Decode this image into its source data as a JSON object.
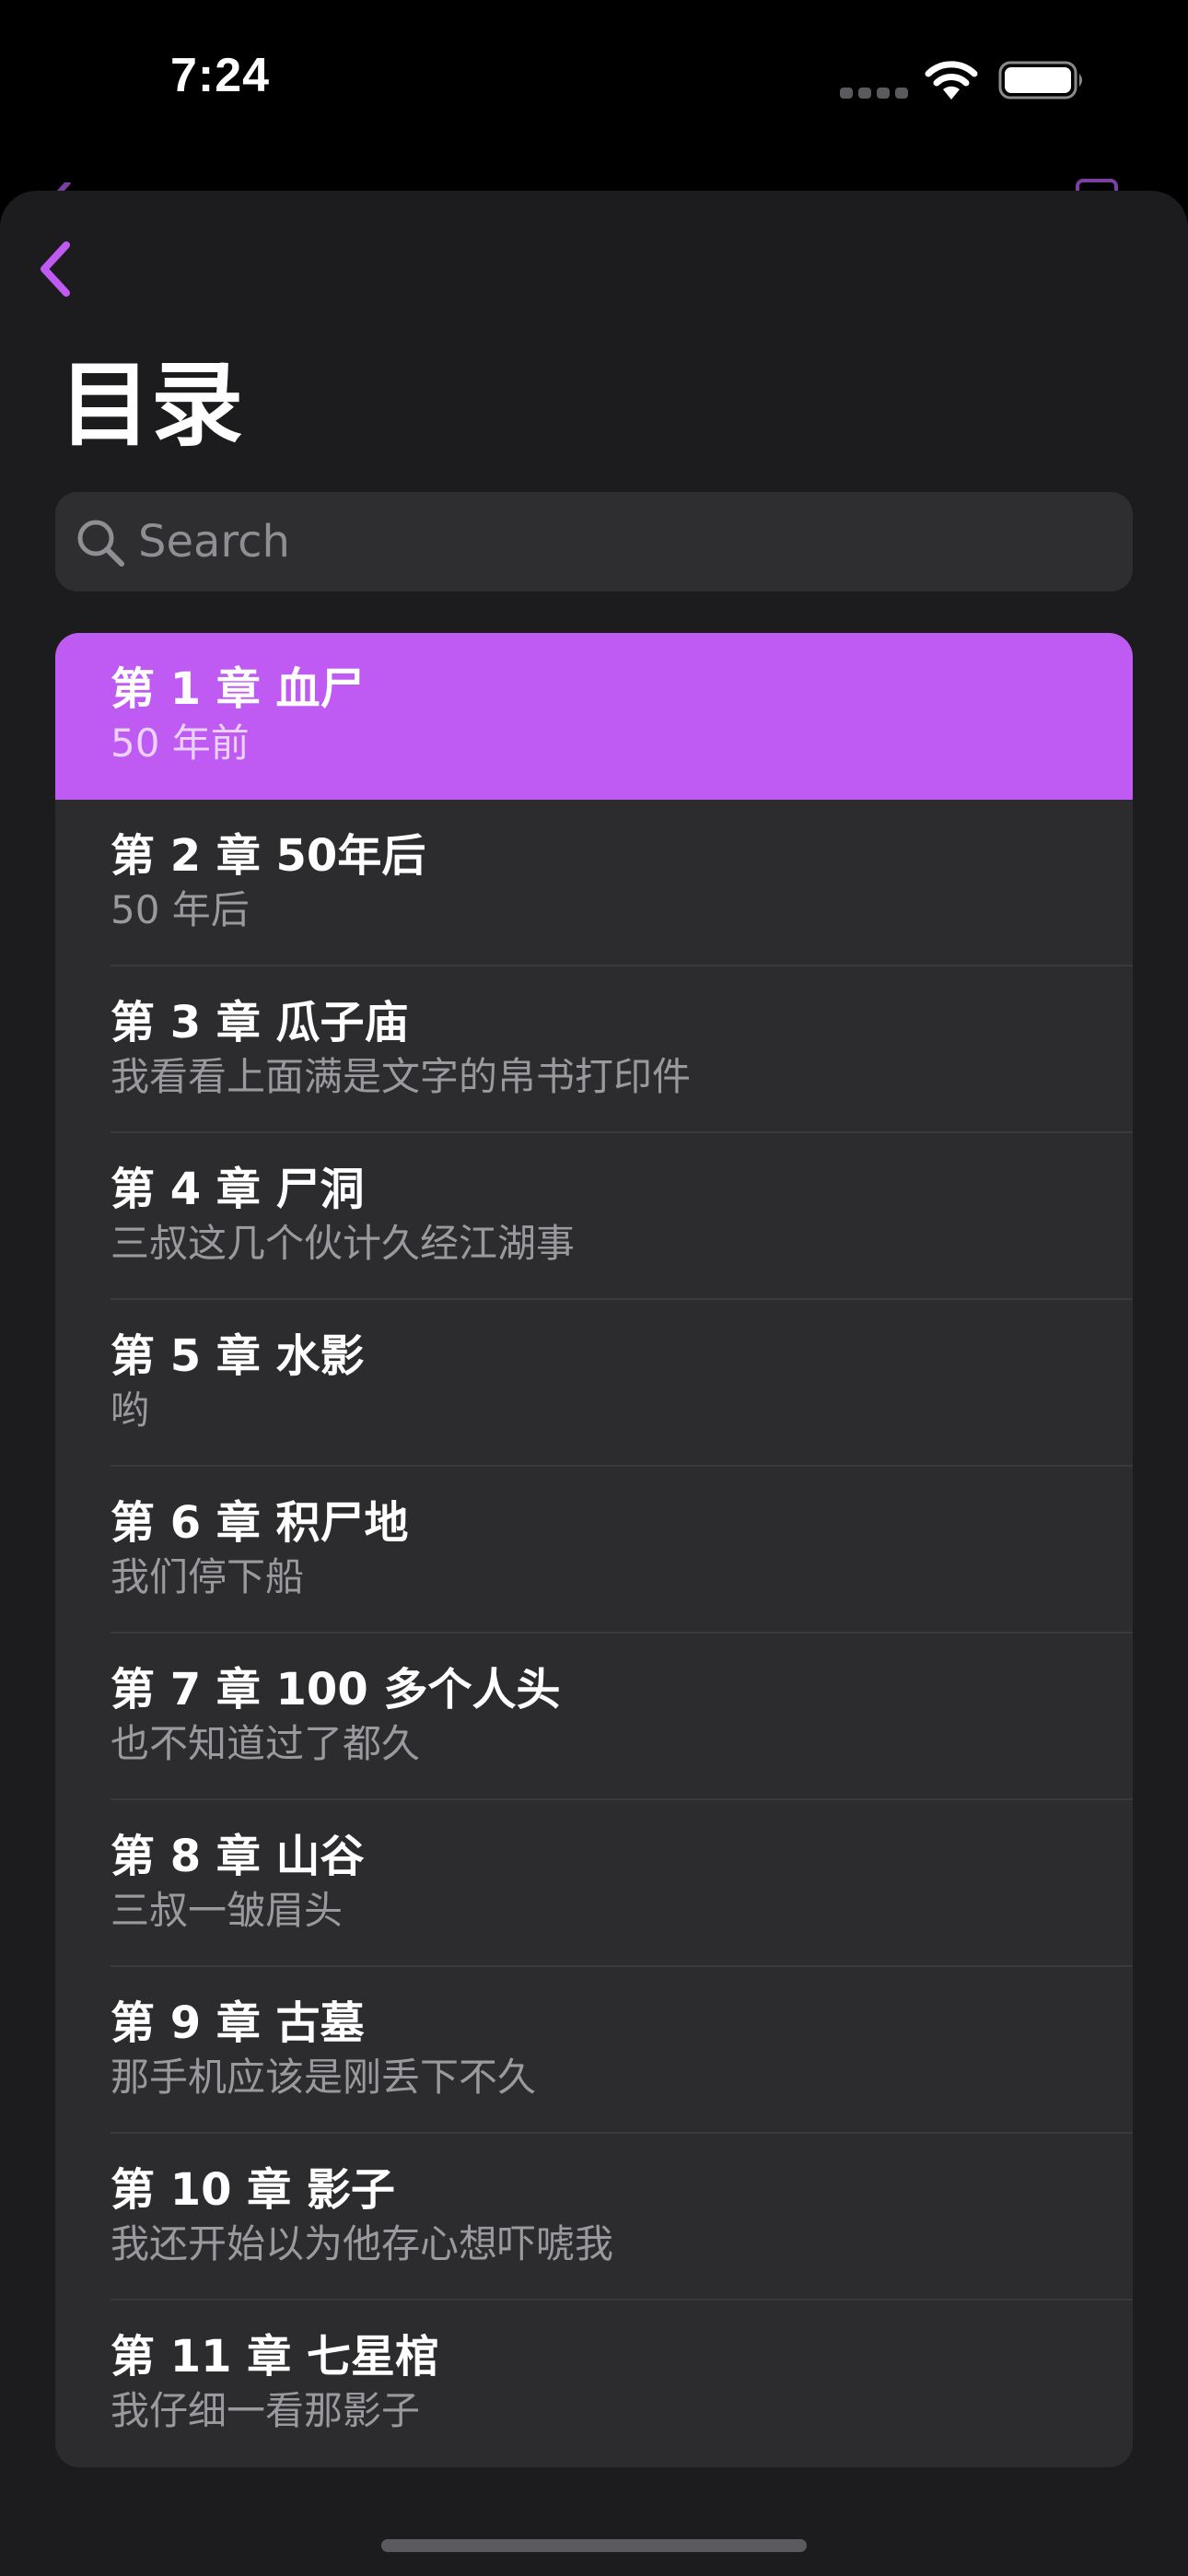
{
  "status_bar": {
    "time": "7:24"
  },
  "nav": {
    "back_icon": "chevron-left-icon",
    "accent_color": "#bf5af2"
  },
  "page": {
    "title": "目录"
  },
  "search": {
    "placeholder": "Search",
    "value": "",
    "icon": "magnifying-glass-icon"
  },
  "chapters": [
    {
      "title": "第 1 章 血尸",
      "subtitle": "50 年前",
      "selected": true
    },
    {
      "title": "第 2 章 50年后",
      "subtitle": "50 年后",
      "selected": false
    },
    {
      "title": "第 3 章 瓜子庙",
      "subtitle": "我看看上面满是文字的帛书打印件",
      "selected": false
    },
    {
      "title": "第 4 章 尸洞",
      "subtitle": "三叔这几个伙计久经江湖事",
      "selected": false
    },
    {
      "title": "第 5 章 水影",
      "subtitle": "哟",
      "selected": false
    },
    {
      "title": "第 6 章 积尸地",
      "subtitle": "我们停下船",
      "selected": false
    },
    {
      "title": "第 7 章 100 多个人头",
      "subtitle": "也不知道过了都久",
      "selected": false
    },
    {
      "title": "第 8 章 山谷",
      "subtitle": "三叔一皱眉头",
      "selected": false
    },
    {
      "title": "第 9 章 古墓",
      "subtitle": "那手机应该是刚丢下不久",
      "selected": false
    },
    {
      "title": "第 10 章 影子",
      "subtitle": "我还开始以为他存心想吓唬我",
      "selected": false
    },
    {
      "title": "第 11 章 七星棺",
      "subtitle": "我仔细一看那影子",
      "selected": false
    }
  ]
}
